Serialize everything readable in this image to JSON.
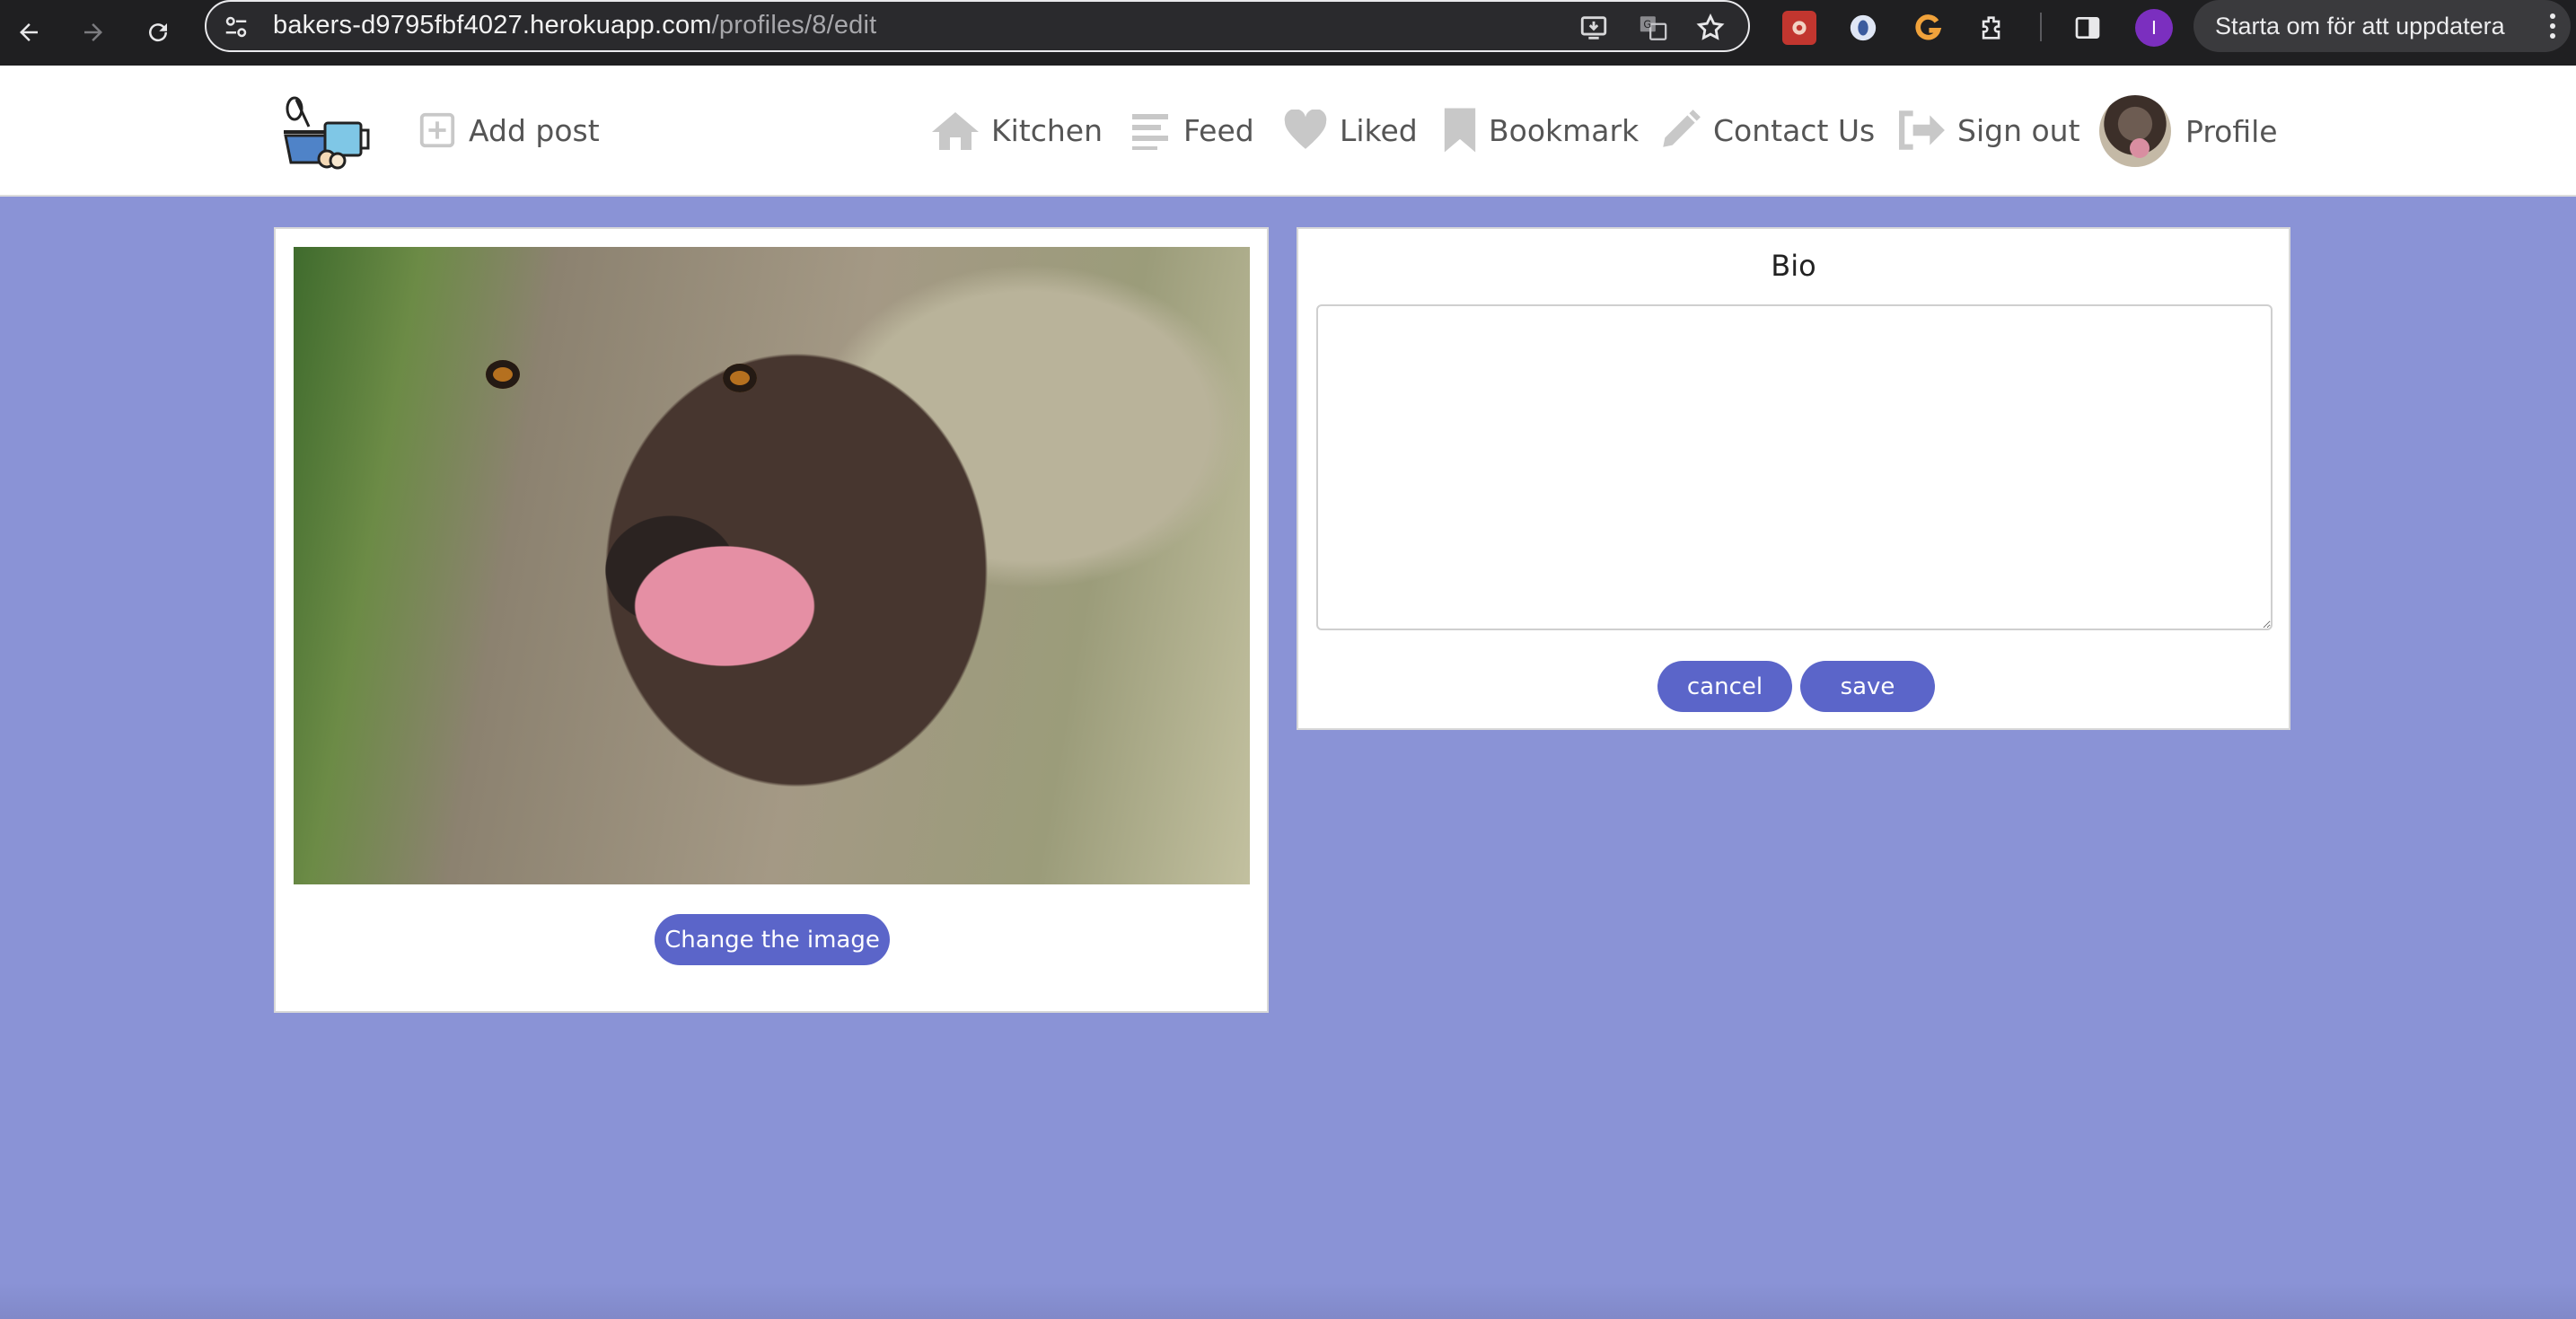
{
  "browser": {
    "url_host": "bakers-d9795fbf4027.herokuapp.com",
    "url_path": "/profiles/8/edit",
    "profile_initial": "I",
    "update_label": "Starta om för att uppdatera",
    "icons": [
      "back-icon",
      "forward-icon",
      "reload-icon",
      "site-settings-icon",
      "install-icon",
      "translate-icon",
      "star-icon",
      "extension-red-icon",
      "extension-eye-icon",
      "extension-grammarly-icon",
      "extensions-puzzle-icon",
      "side-panel-icon",
      "more-menu-icon"
    ]
  },
  "nav": {
    "add_post": "Add post",
    "kitchen": "Kitchen",
    "feed": "Feed",
    "liked": "Liked",
    "bookmark": "Bookmark",
    "contact": "Contact Us",
    "signout": "Sign out",
    "profile": "Profile"
  },
  "image_card": {
    "change_button": "Change the image"
  },
  "bio_card": {
    "title": "Bio",
    "bio_value": "",
    "cancel_label": "cancel",
    "save_label": "save"
  },
  "colors": {
    "page_bg": "#8a93d6",
    "button": "#5b65c9",
    "nav_text": "#555555",
    "nav_icon": "#c8c8c8"
  }
}
